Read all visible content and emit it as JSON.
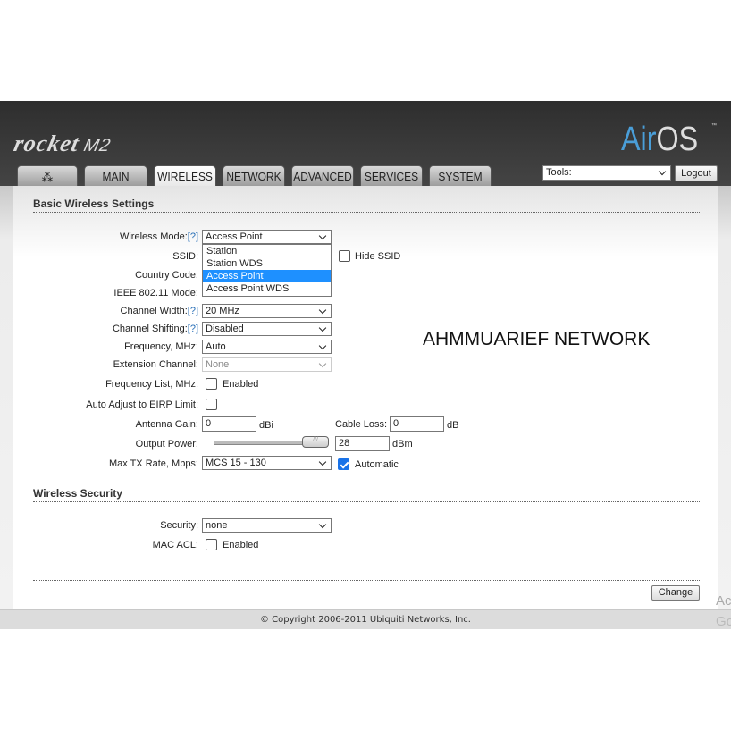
{
  "header": {
    "product": "rocket",
    "model": "M2",
    "brand_logo": "AirOS",
    "brand_air": "Air",
    "brand_os": "OS",
    "tm": "™"
  },
  "tabs": [
    {
      "label": "",
      "icon": "ubiquiti-logo-icon"
    },
    {
      "label": "MAIN"
    },
    {
      "label": "WIRELESS",
      "active": true
    },
    {
      "label": "NETWORK"
    },
    {
      "label": "ADVANCED"
    },
    {
      "label": "SERVICES"
    },
    {
      "label": "SYSTEM"
    }
  ],
  "tools": {
    "value": "Tools:",
    "logout": "Logout"
  },
  "basic": {
    "title": "Basic Wireless Settings",
    "wireless_mode": {
      "label": "Wireless Mode:",
      "help": "[?]",
      "value": "Access Point",
      "options": [
        "Station",
        "Station WDS",
        "Access Point",
        "Access Point WDS"
      ],
      "highlighted": "Access Point"
    },
    "ssid": {
      "label": "SSID:",
      "hide_label": "Hide SSID",
      "hide": false
    },
    "country": {
      "label": "Country Code:"
    },
    "ieee": {
      "label": "IEEE 802.11 Mode:"
    },
    "channel_width": {
      "label": "Channel Width:",
      "help": "[?]",
      "value": "20 MHz"
    },
    "channel_shift": {
      "label": "Channel Shifting:",
      "help": "[?]",
      "value": "Disabled"
    },
    "frequency": {
      "label": "Frequency, MHz:",
      "value": "Auto"
    },
    "extension": {
      "label": "Extension Channel:",
      "value": "None"
    },
    "freq_list": {
      "label": "Frequency List, MHz:",
      "cb_label": "Enabled",
      "checked": false
    },
    "eirp": {
      "label": "Auto Adjust to EIRP Limit:",
      "checked": false
    },
    "antenna": {
      "label": "Antenna Gain:",
      "value": "0",
      "unit": "dBi"
    },
    "cable": {
      "label": "Cable Loss:",
      "value": "0",
      "unit": "dB"
    },
    "output": {
      "label": "Output Power:",
      "value": "28",
      "unit": "dBm",
      "slider_percent": 100
    },
    "txrate": {
      "label": "Max TX Rate, Mbps:",
      "value": "MCS 15 - 130",
      "auto_label": "Automatic",
      "auto": true
    }
  },
  "overlay_text": "AHMMUARIEF NETWORK",
  "security": {
    "title": "Wireless Security",
    "security": {
      "label": "Security:",
      "value": "none"
    },
    "macacl": {
      "label": "MAC ACL:",
      "cb_label": "Enabled",
      "checked": false
    }
  },
  "change": "Change",
  "footer": "© Copyright 2006-2011 Ubiquiti Networks, Inc.",
  "watermark": [
    "Ac",
    "Go"
  ]
}
